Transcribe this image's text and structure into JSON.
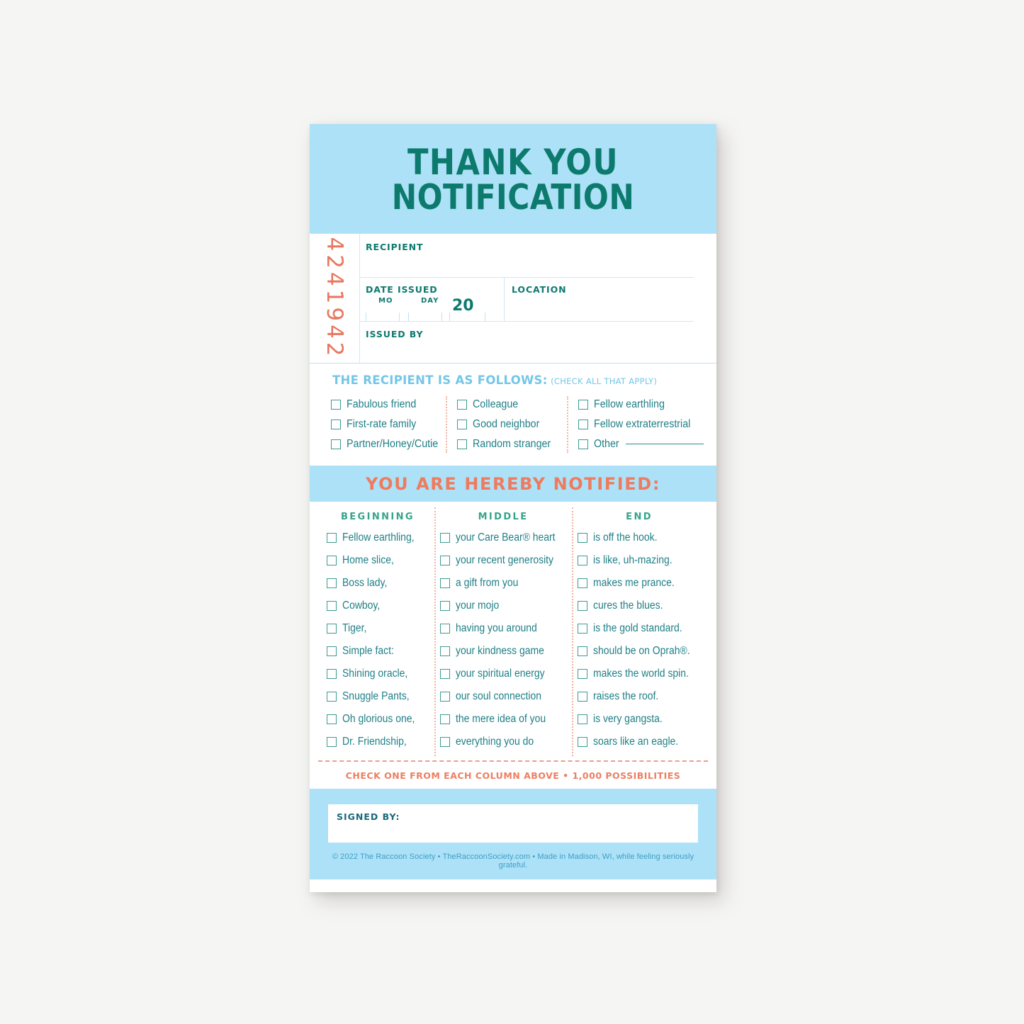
{
  "card": {
    "title": {
      "line1": "THANK YOU",
      "line2": "NOTIFICATION"
    },
    "serial": "4241942",
    "form": {
      "recipient_label": "RECIPIENT",
      "date_issued_label": "DATE ISSUED",
      "month_label": "MO",
      "day_label": "DAY",
      "year_prefix": "20",
      "location_label": "LOCATION",
      "issued_by_label": "ISSUED BY"
    },
    "recipient_section": {
      "heading": "THE RECIPIENT IS AS FOLLOWS:",
      "subheading": "(CHECK ALL THAT APPLY)",
      "col1": [
        "Fabulous friend",
        "First-rate family",
        "Partner/Honey/Cutie"
      ],
      "col2": [
        "Colleague",
        "Good neighbor",
        "Random stranger"
      ],
      "col3": [
        "Fellow earthling",
        "Fellow extraterrestrial",
        "Other"
      ]
    },
    "hereby_banner": "YOU ARE HEREBY NOTIFIED:",
    "columns": {
      "headers": [
        "BEGINNING",
        "MIDDLE",
        "END"
      ],
      "beginning": [
        "Fellow earthling,",
        "Home slice,",
        "Boss lady,",
        "Cowboy,",
        "Tiger,",
        "Simple fact:",
        "Shining oracle,",
        "Snuggle Pants,",
        "Oh glorious one,",
        "Dr. Friendship,"
      ],
      "middle": [
        "your Care Bear® heart",
        "your recent generosity",
        "a gift from you",
        "your mojo",
        "having you around",
        "your kindness game",
        "your spiritual energy",
        "our soul connection",
        "the mere idea of you",
        "everything you do"
      ],
      "end": [
        "is off the hook.",
        "is like, uh-mazing.",
        "makes me prance.",
        "cures the blues.",
        "is the gold standard.",
        "should be on Oprah®.",
        "makes the world spin.",
        "raises the roof.",
        "is very gangsta.",
        "soars like an eagle."
      ]
    },
    "note": "CHECK ONE FROM EACH COLUMN ABOVE • 1,000 POSSIBILITIES",
    "signed_by_label": "SIGNED BY:",
    "credit": "© 2022 The Raccoon Society • TheRaccoonSociety.com • Made in Madison, WI, while feeling seriously grateful."
  },
  "colors": {
    "sky": "#ade1f7",
    "teal": "#0d7a6e",
    "coral": "#ef7b5e",
    "text_teal": "#1f7f86",
    "light_blue_text": "#74c6e8"
  }
}
